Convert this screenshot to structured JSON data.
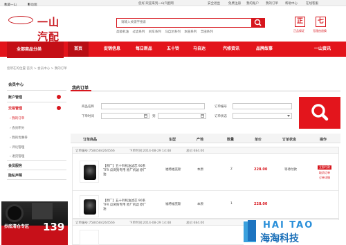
{
  "topbar": {
    "favorite": "收藏一山",
    "mobile": "移动端",
    "welcome": "您好,欢迎来到一山汽配网",
    "safe_exit": "安全退出",
    "free_register": "免费注册",
    "my_account": "我的账户",
    "my_orders": "我的订单",
    "help_center": "帮助中心",
    "service": "在线客服"
  },
  "brand": {
    "logo_text": "一山汽配"
  },
  "search": {
    "placeholder": "请输入关键字搜索",
    "hot_words": [
      "高级机油",
      "过滤系列",
      "刹车系列",
      "马自达系列",
      "本田系列",
      "丰田系列"
    ]
  },
  "badges": [
    {
      "char": "正",
      "caption": "正品保证"
    },
    {
      "char": "七",
      "caption": "无理由退换"
    }
  ],
  "nav": {
    "all_categories": "全部商品分类",
    "items": [
      "首页",
      "促销信息",
      "每日新品",
      "五十铃",
      "马自达",
      "汽修资讯",
      "品牌故事",
      "一山资讯"
    ]
  },
  "breadcrumb": "您所在的位置:首页 > 会员中心 > 我的订单",
  "sidebar": {
    "header": "会员中心",
    "account": "账户管理",
    "trade": "交易管理",
    "sub_items": [
      "我的订单",
      "会员积分",
      "我的优惠券",
      "评论管理",
      "退货管理"
    ],
    "member_service": "会员服务",
    "privacy": "隐私声明"
  },
  "ad": {
    "text": "抄底清仓专区",
    "number": "139"
  },
  "page": {
    "title": "我的订单",
    "filters": {
      "product_name": "商品名称",
      "order_no": "订单编号",
      "order_time": "下单时间",
      "to": "到",
      "status": "订单状态"
    },
    "table_headers": [
      "订单商品",
      "车型",
      "产地",
      "数量",
      "单价",
      "订单状态",
      "操作"
    ]
  },
  "orders": [
    {
      "order_no": "订单编号:7584584264566",
      "time": "下单时间:2014-08-29 14:48",
      "total": "总价:684.00",
      "product": "【原厂】五十铃机油滤芯 90系 TFR 瓜窝狗专用 原厂机滤 原厂油",
      "model": "福特福克斯",
      "origin": "本原",
      "qty": "2",
      "price": "228.00",
      "status": "等待付款",
      "pay_btn": "立即付款",
      "link1": "取消订单",
      "link2": "订单详情"
    },
    {
      "order_no": "订单编号:7584584264566",
      "time": "下单时间:2014-08-29 14:48",
      "total": "总价:684.00",
      "product": "【原厂】五十铃机油滤芯 90系 TFR 瓜窝狗专用 原厂机滤 原厂油",
      "model": "福特福克斯",
      "origin": "本原",
      "qty": "1",
      "price": "228.00",
      "status": "",
      "pay_btn": "",
      "link1": "",
      "link2": ""
    }
  ],
  "watermark": {
    "en": "HAI TAO",
    "cn": "海淘科技"
  },
  "colors": {
    "brand_red": "#d7161d",
    "nav_red": "#e3141b"
  }
}
